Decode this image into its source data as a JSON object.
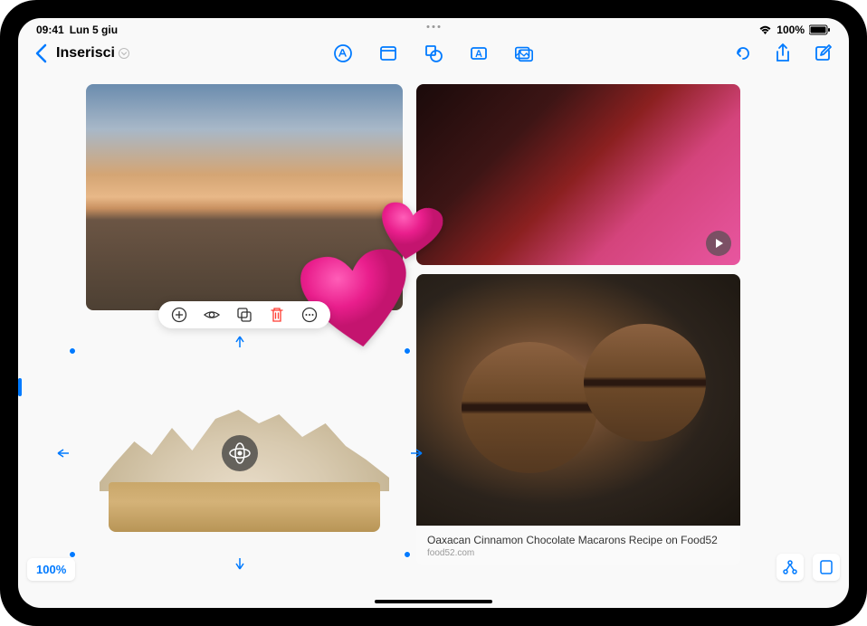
{
  "status": {
    "time": "09:41",
    "date": "Lun 5 giu",
    "battery_percent": "100%"
  },
  "toolbar": {
    "title": "Inserisci"
  },
  "link_preview": {
    "title": "Oaxacan Cinnamon Chocolate Macarons Recipe on Food52",
    "source": "food52.com"
  },
  "zoom": {
    "level": "100%"
  },
  "icons": {
    "markup": "markup-circle-icon",
    "note": "note-icon",
    "media": "media-icon",
    "textbox": "textbox-icon",
    "photo": "photo-icon",
    "undo": "undo-icon",
    "share": "share-icon",
    "compose": "compose-icon"
  }
}
